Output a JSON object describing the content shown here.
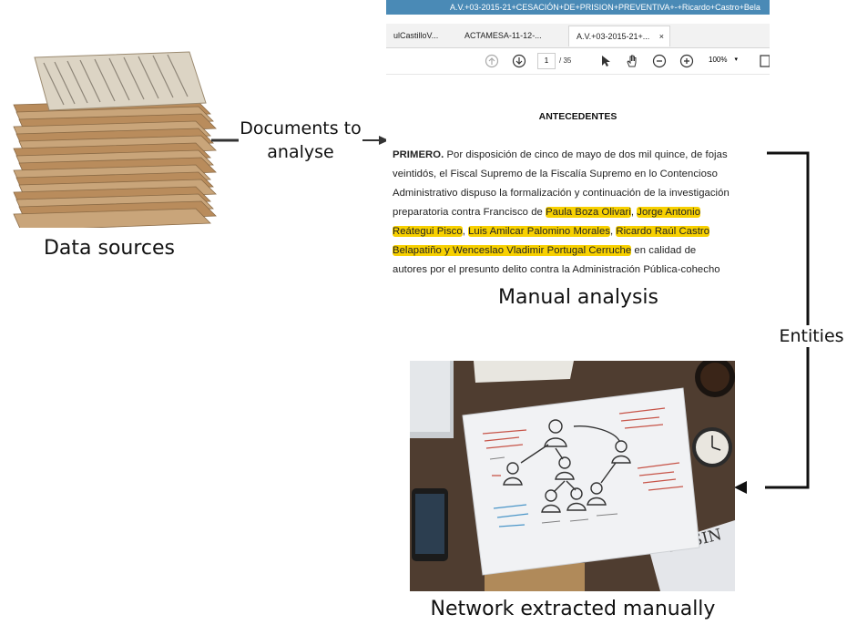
{
  "labels": {
    "data_sources": "Data sources",
    "documents_to_analyse_line1": "Documents to",
    "documents_to_analyse_line2": "analyse",
    "manual_analysis": "Manual analysis",
    "entities": "Entities",
    "network_extracted": "Network extracted manually"
  },
  "pdf_viewer": {
    "window_title": "A.V.+03-2015-21+CESACIÓN+DE+PRISION+PREVENTIVA+-+Ricardo+Castro+Bela",
    "tabs": [
      {
        "label": "ulCastilloV..."
      },
      {
        "label": "ACTAMESA-11-12-..."
      },
      {
        "label": "A.V.+03-2015-21+..."
      }
    ],
    "tab_close": "×",
    "page_current": "1",
    "page_total": "/ 35",
    "zoom": "100%",
    "document": {
      "heading": "ANTECEDENTES",
      "lines": {
        "l1_bold": "PRIMERO.",
        "l1_rest": " Por disposición de cinco de mayo de dos mil quince, de fojas",
        "l2": "veintidós, el Fiscal Supremo de la Fiscalía Supremo en lo Contencioso",
        "l3": "Administrativo dispuso la formalización y continuación de la investigación",
        "l4_a": "preparatoria contra Francisco de ",
        "l4_h1": "Paula Boza Olivari",
        "l4_b": ", ",
        "l4_h2": "Jorge Antonio",
        "l5_h1": "Reátegui Pisco",
        "l5_a": ", ",
        "l5_h2": "Luis Amilcar Palomino Morales",
        "l5_b": ", ",
        "l5_h3": "Ricardo Raúl Castro",
        "l6_h1": "Belapatiño y Wenceslao Vladimir Portugal Cerruche",
        "l6_a": " en calidad de",
        "l7": "autores por el presunto delito contra la Administración Pública-cohecho"
      }
    }
  },
  "colors": {
    "highlight": "#f7d000",
    "arrow": "#111111",
    "titlebar": "#4a8ab6"
  }
}
